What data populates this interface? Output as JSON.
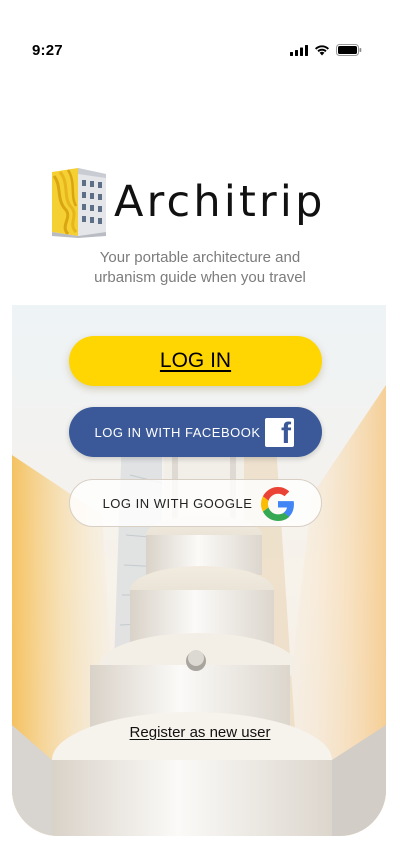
{
  "status_bar": {
    "time": "9:27",
    "icons": [
      "cellular-signal-icon",
      "wifi-icon",
      "battery-icon"
    ]
  },
  "brand": {
    "name": "Architrip",
    "logo_icon": "building-logo-icon",
    "tagline_line1": "Your portable architecture and",
    "tagline_line2": "urbanism guide when you travel"
  },
  "buttons": {
    "login": "LOG IN",
    "facebook": "LOG IN WITH FACEBOOK",
    "google": "LOG IN WITH GOOGLE"
  },
  "links": {
    "register": "Register as new user"
  },
  "colors": {
    "login_button": "#ffd502",
    "facebook_button": "#3b5998",
    "google_button_border": "#d7cfc4"
  }
}
